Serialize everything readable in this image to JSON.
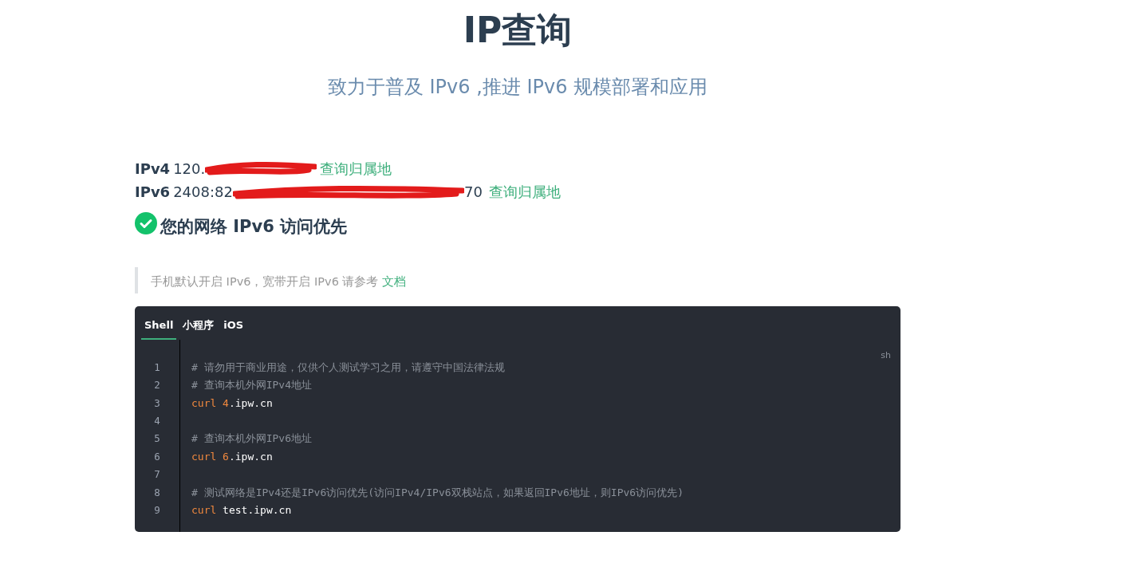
{
  "title": "IP查询",
  "subtitle": "致力于普及 IPv6 ,推进 IPv6 规模部署和应用",
  "addresses": [
    {
      "label": "IPv4",
      "value_start": "120.",
      "link": "查询归属地"
    },
    {
      "label": "IPv6",
      "value_start": "2408:82",
      "value_end": "70",
      "link": "查询归属地"
    }
  ],
  "status": {
    "ok": true,
    "text": "您的网络 IPv6 访问优先"
  },
  "note": {
    "text": "手机默认开启 IPv6，宽带开启 IPv6 请参考",
    "link": "文档"
  },
  "code": {
    "tabs": [
      {
        "label": "Shell",
        "selected": true
      },
      {
        "label": "小程序",
        "selected": false
      },
      {
        "label": "iOS",
        "selected": false
      }
    ],
    "language": "sh",
    "lines": [
      {
        "number": "1",
        "tokens": [
          {
            "kind": "comment",
            "text": "# 请勿用于商业用途，仅供个人测试学习之用，请遵守中国法律法规"
          }
        ]
      },
      {
        "number": "2",
        "tokens": [
          {
            "kind": "comment",
            "text": "# 查询本机外网IPv4地址"
          }
        ]
      },
      {
        "number": "3",
        "tokens": [
          {
            "kind": "keyword",
            "text": "curl"
          },
          {
            "kind": "number",
            "text": "4"
          },
          {
            "kind": "plain",
            "text": ".ipw.cn"
          }
        ]
      },
      {
        "number": "4"
      },
      {
        "number": "5",
        "tokens": [
          {
            "kind": "comment",
            "text": "# 查询本机外网IPv6地址"
          }
        ]
      },
      {
        "number": "6",
        "tokens": [
          {
            "kind": "keyword",
            "text": "curl"
          },
          {
            "kind": "number",
            "text": "6"
          },
          {
            "kind": "plain",
            "text": ".ipw.cn"
          }
        ]
      },
      {
        "number": "7"
      },
      {
        "number": "8",
        "tokens": [
          {
            "kind": "comment",
            "text": "# 测试网络是IPv4还是IPv6访问优先(访问IPv4/IPv6双栈站点，如果返回IPv6地址，则IPv6访问优先)"
          }
        ]
      },
      {
        "number": "9",
        "tokens": [
          {
            "kind": "keyword",
            "text": "curl"
          },
          {
            "kind": "plain",
            "text": "test.ipw.cn"
          }
        ]
      }
    ]
  }
}
